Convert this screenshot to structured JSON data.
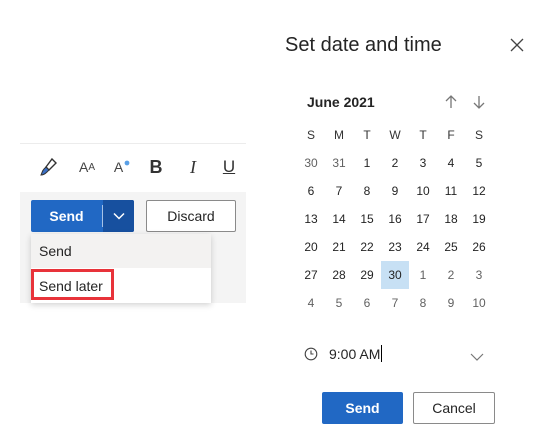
{
  "composer": {
    "toolbar": {
      "format_painter_icon": "format-painter-icon",
      "font_size_label": "A",
      "font_size_small": "A",
      "font_color_label": "A",
      "bold_label": "B",
      "italic_label": "I",
      "underline_label": "U"
    },
    "send_label": "Send",
    "discard_label": "Discard",
    "send_menu": [
      {
        "label": "Send"
      },
      {
        "label": "Send later"
      }
    ]
  },
  "panel": {
    "title": "Set date and time",
    "month": "June 2021",
    "weekdays": [
      "S",
      "M",
      "T",
      "W",
      "T",
      "F",
      "S"
    ],
    "weeks": [
      [
        "30",
        "31",
        "1",
        "2",
        "3",
        "4",
        "5"
      ],
      [
        "6",
        "7",
        "8",
        "9",
        "10",
        "11",
        "12"
      ],
      [
        "13",
        "14",
        "15",
        "16",
        "17",
        "18",
        "19"
      ],
      [
        "20",
        "21",
        "22",
        "23",
        "24",
        "25",
        "26"
      ],
      [
        "27",
        "28",
        "29",
        "30",
        "1",
        "2",
        "3"
      ],
      [
        "4",
        "5",
        "6",
        "7",
        "8",
        "9",
        "10"
      ]
    ],
    "selected_date": "30",
    "time_value": "9:00 AM",
    "send_label": "Send",
    "cancel_label": "Cancel"
  },
  "colors": {
    "primary": "#2168c4",
    "primary_dark": "#17509f",
    "selected_day": "#c7e0f4",
    "highlight": "#e8333a"
  }
}
